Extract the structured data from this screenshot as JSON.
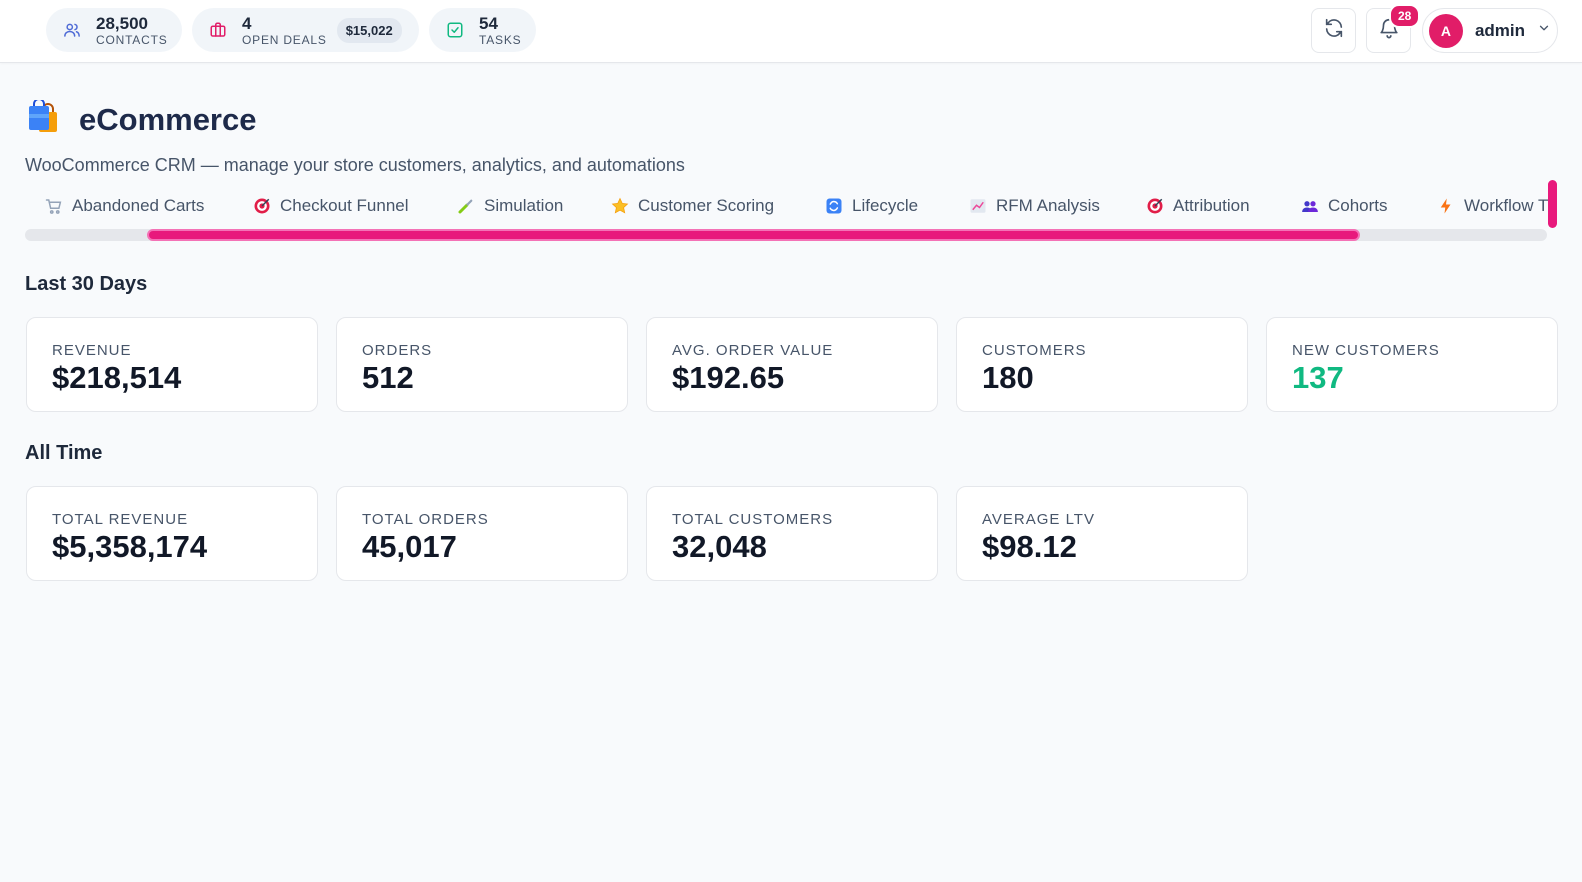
{
  "topbar": {
    "contacts": {
      "count": "28,500",
      "label": "CONTACTS"
    },
    "deals": {
      "count": "4",
      "label": "OPEN DEALS",
      "amount": "$15,022"
    },
    "tasks": {
      "count": "54",
      "label": "TASKS"
    },
    "notifications": {
      "count": "28"
    },
    "user": {
      "initial": "A",
      "name": "admin"
    }
  },
  "page": {
    "title": "eCommerce",
    "subtitle": "WooCommerce CRM — manage your store customers, analytics, and automations"
  },
  "tabs": [
    {
      "label": "Abandoned Carts",
      "icon": "cart-icon"
    },
    {
      "label": "Checkout Funnel",
      "icon": "target-icon"
    },
    {
      "label": "Simulation",
      "icon": "pipette-icon"
    },
    {
      "label": "Customer Scoring",
      "icon": "star-icon"
    },
    {
      "label": "Lifecycle",
      "icon": "refresh-icon"
    },
    {
      "label": "RFM Analysis",
      "icon": "chart-icon"
    },
    {
      "label": "Attribution",
      "icon": "target-icon"
    },
    {
      "label": "Cohorts",
      "icon": "people-icon"
    },
    {
      "label": "Workflow T",
      "icon": "lightning-icon"
    }
  ],
  "sections": {
    "last30": {
      "title": "Last 30 Days",
      "cards": [
        {
          "label": "REVENUE",
          "value": "$218,514"
        },
        {
          "label": "ORDERS",
          "value": "512"
        },
        {
          "label": "AVG. ORDER VALUE",
          "value": "$192.65"
        },
        {
          "label": "CUSTOMERS",
          "value": "180"
        },
        {
          "label": "NEW CUSTOMERS",
          "value": "137"
        }
      ]
    },
    "alltime": {
      "title": "All Time",
      "cards": [
        {
          "label": "TOTAL REVENUE",
          "value": "$5,358,174"
        },
        {
          "label": "TOTAL ORDERS",
          "value": "45,017"
        },
        {
          "label": "TOTAL CUSTOMERS",
          "value": "32,048"
        },
        {
          "label": "AVERAGE LTV",
          "value": "$98.12"
        }
      ]
    }
  },
  "colors": {
    "accent": "#e8197c",
    "positive": "#10b981",
    "title": "#1e2a4a"
  }
}
